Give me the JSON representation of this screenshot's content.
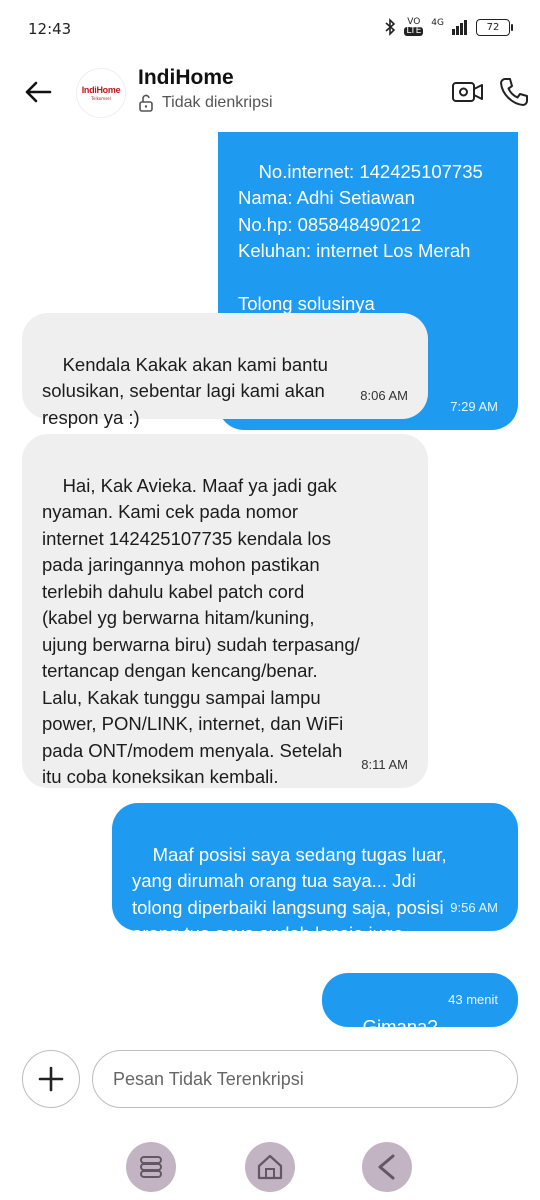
{
  "status_bar": {
    "time": "12:43",
    "network_top": "VO",
    "network_badge": "LTE",
    "network_type": "4G",
    "battery": "72"
  },
  "header": {
    "contact_name": "IndiHome",
    "encryption_status": "Tidak dienkripsi",
    "avatar_text": "IndiHome",
    "avatar_subtext": "Telkomsel"
  },
  "messages": [
    {
      "direction": "outgoing",
      "text": "No.internet: 142425107735\nNama: Adhi Setiawan\nNo.hp: 085848490212\nKeluhan: internet Los Merah\n\nTolong solusinya",
      "time": "7:29 AM"
    },
    {
      "direction": "incoming",
      "text": "Kendala Kakak akan kami bantu\nsolusikan, sebentar lagi kami akan\nrespon ya :)",
      "time": "8:06 AM"
    },
    {
      "direction": "incoming",
      "text": "Hai, Kak Avieka. Maaf ya jadi gak\nnyaman. Kami cek pada nomor\ninternet 142425107735 kendala los\npada jaringannya mohon pastikan\nterlebih dahulu kabel patch cord\n(kabel yg berwarna hitam/kuning,\nujung berwarna biru) sudah terpasang/\ntertancap dengan kencang/benar.\nLalu, Kakak tunggu sampai lampu\npower, PON/LINK, internet, dan WiFi\npada ONT/modem menyala. Setelah\nitu coba koneksikan kembali.",
      "time": "8:11 AM"
    },
    {
      "direction": "outgoing",
      "text": "Maaf posisi saya sedang tugas luar,\nyang dirumah orang tua saya... Jdi\ntolong diperbaiki langsung saja, posisi\norang tua saya sudah lansia juga",
      "time": "9:56 AM"
    },
    {
      "direction": "outgoing",
      "text": "Gimana?",
      "time": "43 menit"
    }
  ],
  "compose": {
    "placeholder": "Pesan Tidak Terenkripsi"
  },
  "colors": {
    "outgoing_bubble": "#1e9bf0",
    "incoming_bubble": "#efefef",
    "brand_red": "#c4151c"
  },
  "icons": [
    "back-arrow-icon",
    "lock-open-icon",
    "video-call-icon",
    "phone-icon",
    "plus-icon",
    "recent-apps-icon",
    "home-icon",
    "back-icon"
  ]
}
